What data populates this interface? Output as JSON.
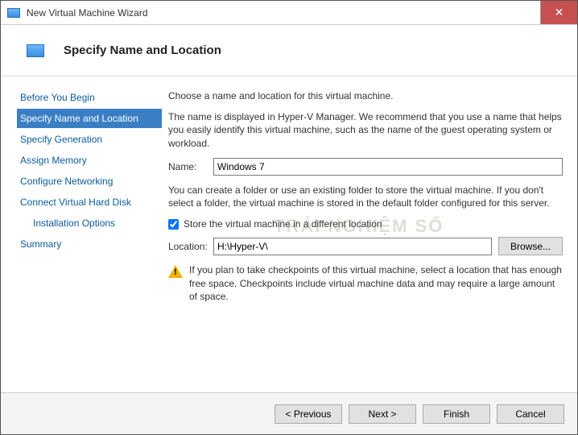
{
  "window": {
    "title": "New Virtual Machine Wizard"
  },
  "header": {
    "title": "Specify Name and Location"
  },
  "sidebar": {
    "steps": [
      {
        "label": "Before You Begin",
        "active": false
      },
      {
        "label": "Specify Name and Location",
        "active": true
      },
      {
        "label": "Specify Generation",
        "active": false
      },
      {
        "label": "Assign Memory",
        "active": false
      },
      {
        "label": "Configure Networking",
        "active": false
      },
      {
        "label": "Connect Virtual Hard Disk",
        "active": false
      },
      {
        "label": "Installation Options",
        "active": false,
        "indent": true
      },
      {
        "label": "Summary",
        "active": false
      }
    ]
  },
  "content": {
    "intro": "Choose a name and location for this virtual machine.",
    "name_desc": "The name is displayed in Hyper-V Manager. We recommend that you use a name that helps you easily identify this virtual machine, such as the name of the guest operating system or workload.",
    "name_label": "Name:",
    "name_value": "Windows 7",
    "folder_desc": "You can create a folder or use an existing folder to store the virtual machine. If you don't select a folder, the virtual machine is stored in the default folder configured for this server.",
    "store_checkbox": "Store the virtual machine in a different location",
    "store_checked": true,
    "location_label": "Location:",
    "location_value": "H:\\Hyper-V\\",
    "browse_label": "Browse...",
    "warning": "If you plan to take checkpoints of this virtual machine, select a location that has enough free space. Checkpoints include virtual machine data and may require a large amount of space."
  },
  "footer": {
    "previous": "< Previous",
    "next": "Next >",
    "finish": "Finish",
    "cancel": "Cancel"
  },
  "watermark": "TRẢI NGHIỆM SỐ"
}
